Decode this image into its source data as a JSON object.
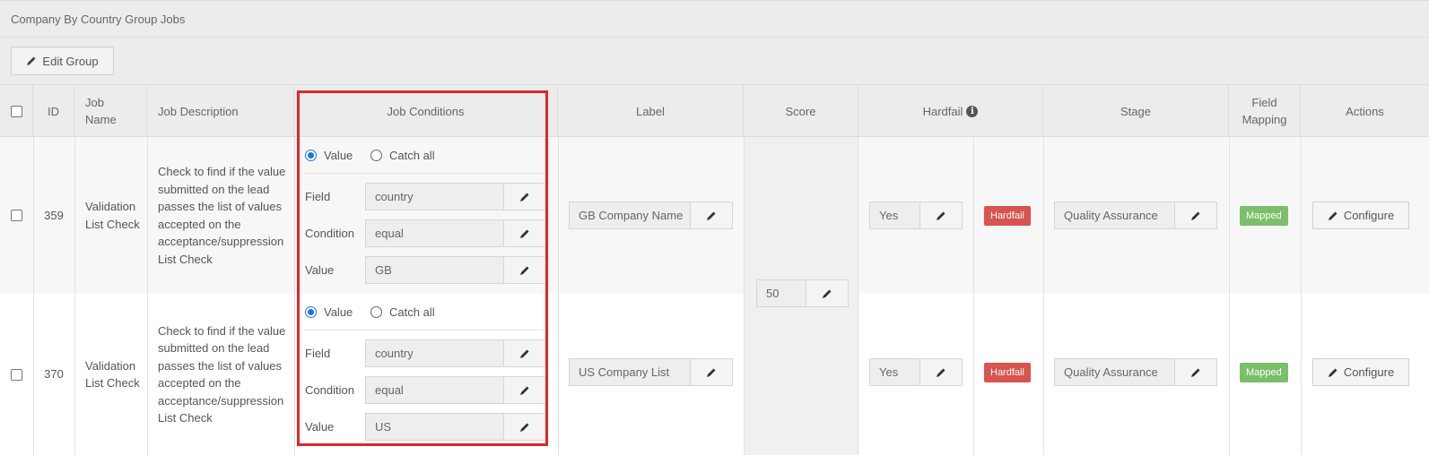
{
  "panel": {
    "title": "Company By Country Group Jobs"
  },
  "toolbar": {
    "edit_group_label": "Edit Group"
  },
  "table": {
    "headers": {
      "id": "ID",
      "job_name": "Job Name",
      "job_description": "Job Description",
      "job_conditions": "Job Conditions",
      "label": "Label",
      "score": "Score",
      "hardfail": "Hardfail",
      "stage": "Stage",
      "field_mapping": "Field Mapping",
      "actions": "Actions"
    },
    "rows": [
      {
        "id": "359",
        "job_name": "Validation List Check",
        "job_description": "Check to find if the value submitted on the lead passes the list of values accepted on the acceptance/suppression List Check",
        "radio_value": "Value",
        "radio_catch_all": "Catch all",
        "field_label": "Field",
        "field_value": "country",
        "condition_label": "Condition",
        "condition_value": "equal",
        "value_label": "Value",
        "value_value": "GB",
        "label": "GB Company Name",
        "hardfail_value": "Yes",
        "hardfail_badge": "Hardfail",
        "stage": "Quality Assurance",
        "mapping_badge": "Mapped",
        "configure_label": "Configure"
      },
      {
        "id": "370",
        "job_name": "Validation List Check",
        "job_description": "Check to find if the value submitted on the lead passes the list of values accepted on the acceptance/suppression List Check",
        "radio_value": "Value",
        "radio_catch_all": "Catch all",
        "field_label": "Field",
        "field_value": "country",
        "condition_label": "Condition",
        "condition_value": "equal",
        "value_label": "Value",
        "value_value": "US",
        "label": "US Company List",
        "hardfail_value": "Yes",
        "hardfail_badge": "Hardfail",
        "stage": "Quality Assurance",
        "mapping_badge": "Mapped",
        "configure_label": "Configure"
      }
    ],
    "score": "50"
  },
  "colors": {
    "highlight_border": "#e0262b",
    "hardfail_badge": "#d9534f",
    "mapped_badge": "#7bbf6a",
    "radio_accent": "#1a73e8"
  },
  "icons": {
    "edit": "pencil-icon",
    "info": "info-circle-icon"
  }
}
